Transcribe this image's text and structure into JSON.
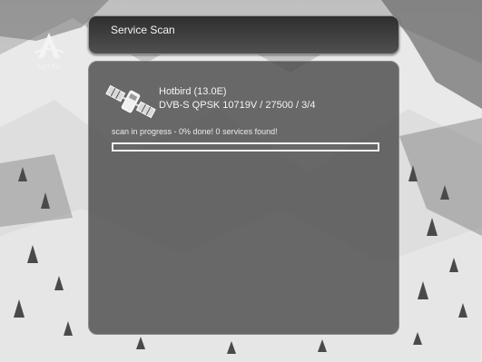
{
  "logo": {
    "label": "ASTRA"
  },
  "header": {
    "title": "Service Scan"
  },
  "scan": {
    "satellite": "Hotbird (13.0E)",
    "transponder": "DVB-S QPSK 10719V / 27500 / 3/4",
    "status": "scan in progress - 0% done! 0 services found!",
    "progress_fraction": 0
  }
}
